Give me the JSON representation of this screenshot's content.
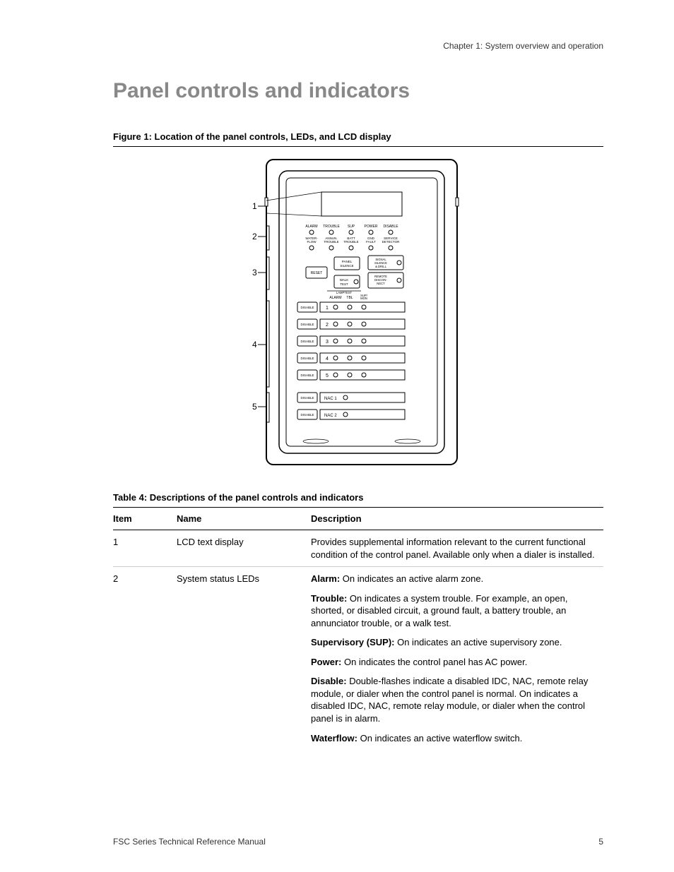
{
  "header": {
    "chapter": "Chapter 1: System overview and operation"
  },
  "title": "Panel controls and indicators",
  "figure": {
    "caption": "Figure 1: Location of the panel controls, LEDs, and LCD display",
    "callouts": [
      "1",
      "2",
      "3",
      "4",
      "5"
    ],
    "labels": {
      "row1": [
        "ALARM",
        "TROUBLE",
        "SUP",
        "POWER",
        "DISABLE"
      ],
      "row2a": [
        "WATER-",
        "ANNUN.",
        "BATT",
        "GND",
        "SERVICE"
      ],
      "row2b": [
        "FLOW",
        "TROUBLE",
        "TROUBLE",
        "FAULT",
        "DETECTOR"
      ],
      "reset": "RESET",
      "panel_silence": "PANEL SILENCE",
      "signal_silence": "SIGNAL SILENCE & DRILL",
      "walk_test": "WALK TEST",
      "lamptest": "LAMPTEST",
      "remote_disconnect": "REMOTE DISCON-NECT",
      "zone_header": [
        "ALARM",
        "TBL",
        "SUP/ MON"
      ],
      "disable": "DISABLE",
      "nac1": "NAC 1",
      "nac2": "NAC 2",
      "zones": [
        "1",
        "2",
        "3",
        "4",
        "5"
      ]
    }
  },
  "table": {
    "caption": "Table 4: Descriptions of the panel controls and indicators",
    "headers": {
      "item": "Item",
      "name": "Name",
      "description": "Description"
    },
    "rows": [
      {
        "item": "1",
        "name": "LCD text display",
        "desc_plain": "Provides supplemental information relevant to the current functional condition of the control panel. Available only when a dialer is installed."
      },
      {
        "item": "2",
        "name": "System status LEDs",
        "desc_parts": [
          {
            "label": "Alarm:",
            "text": " On indicates an active alarm zone."
          },
          {
            "label": "Trouble:",
            "text": " On indicates a system trouble. For example, an open, shorted, or disabled circuit, a ground fault, a battery trouble, an annunciator trouble, or a walk test."
          },
          {
            "label": "Supervisory (SUP):",
            "text": " On indicates an active supervisory zone."
          },
          {
            "label": "Power:",
            "text": " On indicates the control panel has AC power."
          },
          {
            "label": "Disable:",
            "text": " Double-flashes indicate a disabled IDC, NAC, remote relay module, or dialer when the control panel is normal. On indicates a disabled IDC, NAC, remote relay module, or dialer when the control panel is in alarm."
          },
          {
            "label": "Waterflow:",
            "text": " On indicates an active waterflow switch."
          }
        ]
      }
    ]
  },
  "footer": {
    "left": "FSC Series Technical Reference Manual",
    "right": "5"
  }
}
